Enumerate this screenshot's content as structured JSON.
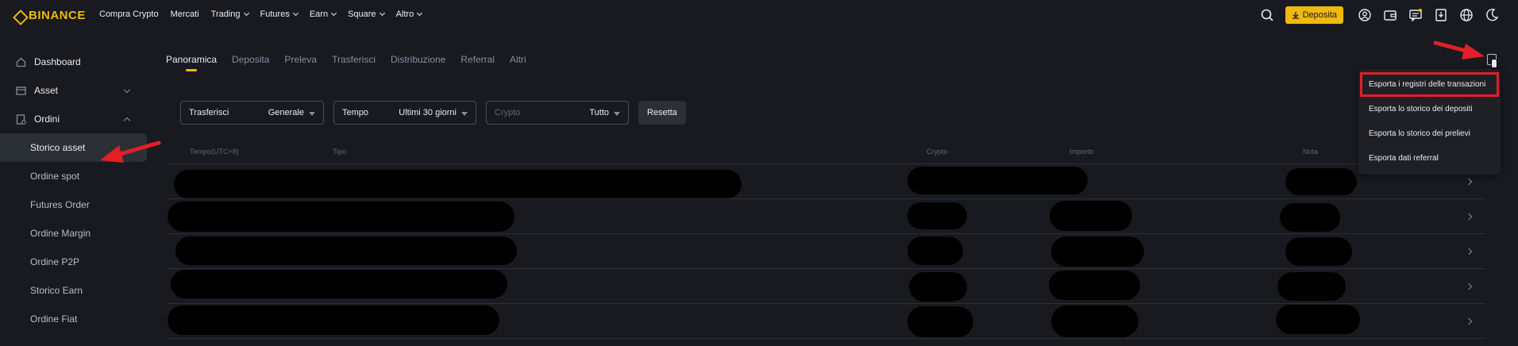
{
  "brand": {
    "name": "BINANCE",
    "color": "#f0b90b"
  },
  "nav": {
    "items": [
      {
        "label": "Compra Crypto",
        "dropdown": false
      },
      {
        "label": "Mercati",
        "dropdown": false
      },
      {
        "label": "Trading",
        "dropdown": true
      },
      {
        "label": "Futures",
        "dropdown": true
      },
      {
        "label": "Earn",
        "dropdown": true
      },
      {
        "label": "Square",
        "dropdown": true
      },
      {
        "label": "Altro",
        "dropdown": true
      }
    ],
    "deposit_label": "Deposita",
    "icons": [
      "search-icon",
      "download-icon",
      "user-icon",
      "wallet-icon",
      "message-icon",
      "app-download-icon",
      "globe-icon",
      "moon-icon"
    ]
  },
  "sidebar": {
    "dashboard": "Dashboard",
    "asset": "Asset",
    "orders": "Ordini",
    "sub_items": [
      "Storico asset",
      "Ordine spot",
      "Futures Order",
      "Ordine Margin",
      "Ordine P2P",
      "Storico Earn",
      "Ordine Fiat"
    ],
    "active": "Storico asset"
  },
  "tabs": [
    "Panoramica",
    "Deposita",
    "Preleva",
    "Trasferisci",
    "Distribuzione",
    "Referral",
    "Altri"
  ],
  "active_tab": "Panoramica",
  "filters": {
    "type_label": "Trasferisci",
    "type_value": "Generale",
    "time_label": "Tempo",
    "time_value": "Ultimi 30 giorni",
    "crypto_label": "Crypto",
    "crypto_value": "Tutto",
    "reset_label": "Resetta"
  },
  "table": {
    "columns": [
      "Tempo(UTC+8)",
      "Tipo",
      "Crypto",
      "Importo",
      "Nota"
    ],
    "row_count": 5
  },
  "export_menu": {
    "items": [
      "Esporta i registri delle transazioni",
      "Esporta lo storico dei depositi",
      "Esporta lo storico dei prelievi",
      "Esporta dati referral"
    ],
    "highlighted": 0
  },
  "colors": {
    "accent": "#f0b90b",
    "annotation": "#e21f26",
    "background": "#181a20"
  }
}
